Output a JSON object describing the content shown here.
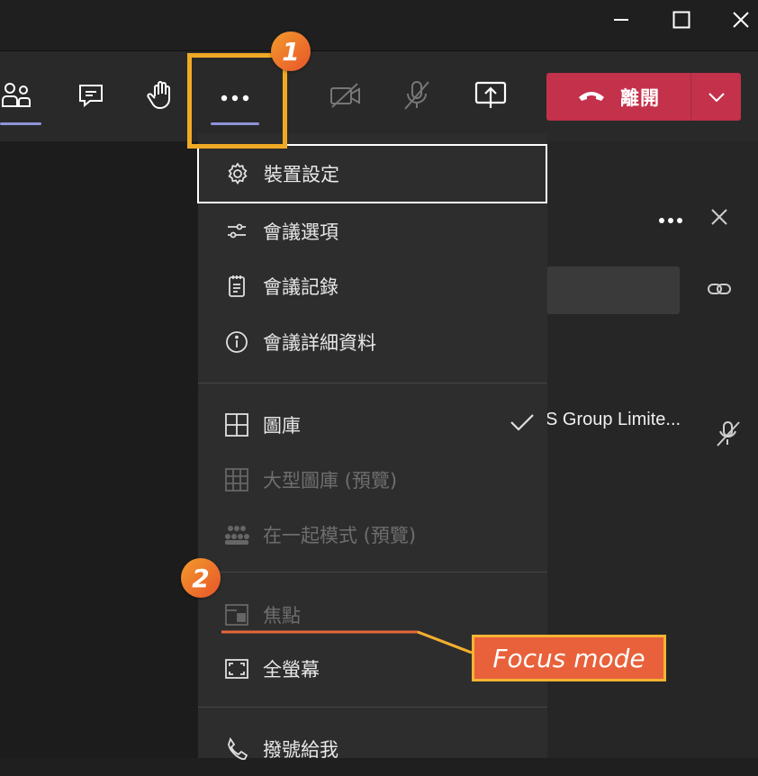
{
  "window": {
    "minimize_icon": "minimize-icon",
    "maximize_icon": "maximize-icon",
    "close_icon": "close-icon"
  },
  "toolbar": {
    "buttons": [
      {
        "name": "participants",
        "icon": "people-icon"
      },
      {
        "name": "chat",
        "icon": "chat-icon"
      },
      {
        "name": "raise-hand",
        "icon": "hand-icon"
      },
      {
        "name": "more-actions",
        "icon": "more-icon"
      },
      {
        "name": "camera",
        "icon": "camera-off-icon"
      },
      {
        "name": "mic",
        "icon": "mic-off-icon"
      },
      {
        "name": "share",
        "icon": "share-screen-icon"
      }
    ],
    "leave": {
      "label": "離開",
      "icon": "hang-up-icon",
      "dropdown_icon": "chevron-down-icon"
    }
  },
  "menu": {
    "items": [
      {
        "label": "裝置設定",
        "icon": "gear-icon",
        "enabled": true
      },
      {
        "label": "會議選項",
        "icon": "sliders-icon",
        "enabled": true
      },
      {
        "label": "會議記錄",
        "icon": "notes-icon",
        "enabled": true
      },
      {
        "label": "會議詳細資料",
        "icon": "info-icon",
        "enabled": true
      },
      {
        "label": "圖庫",
        "icon": "grid-icon",
        "enabled": true,
        "checked": true
      },
      {
        "label": "大型圖庫 (預覽)",
        "icon": "large-grid-icon",
        "enabled": false
      },
      {
        "label": "在一起模式 (預覽)",
        "icon": "together-icon",
        "enabled": false
      },
      {
        "label": "焦點",
        "icon": "focus-icon",
        "enabled": false
      },
      {
        "label": "全螢幕",
        "icon": "fullscreen-icon",
        "enabled": true
      },
      {
        "label": "撥號給我",
        "icon": "phone-icon",
        "enabled": true
      }
    ]
  },
  "panel": {
    "more_icon": "more-icon",
    "close_icon": "close-icon",
    "link_icon": "link-icon",
    "participant_name": "S Group Limite...",
    "participant_mic_icon": "mic-off-icon"
  },
  "annotations": {
    "badge_1": "1",
    "badge_2": "2",
    "focus_label": "Focus mode"
  },
  "colors": {
    "leave_red": "#c4314b",
    "accent": "#8f93d9",
    "highlight_orange": "#f0a925"
  }
}
